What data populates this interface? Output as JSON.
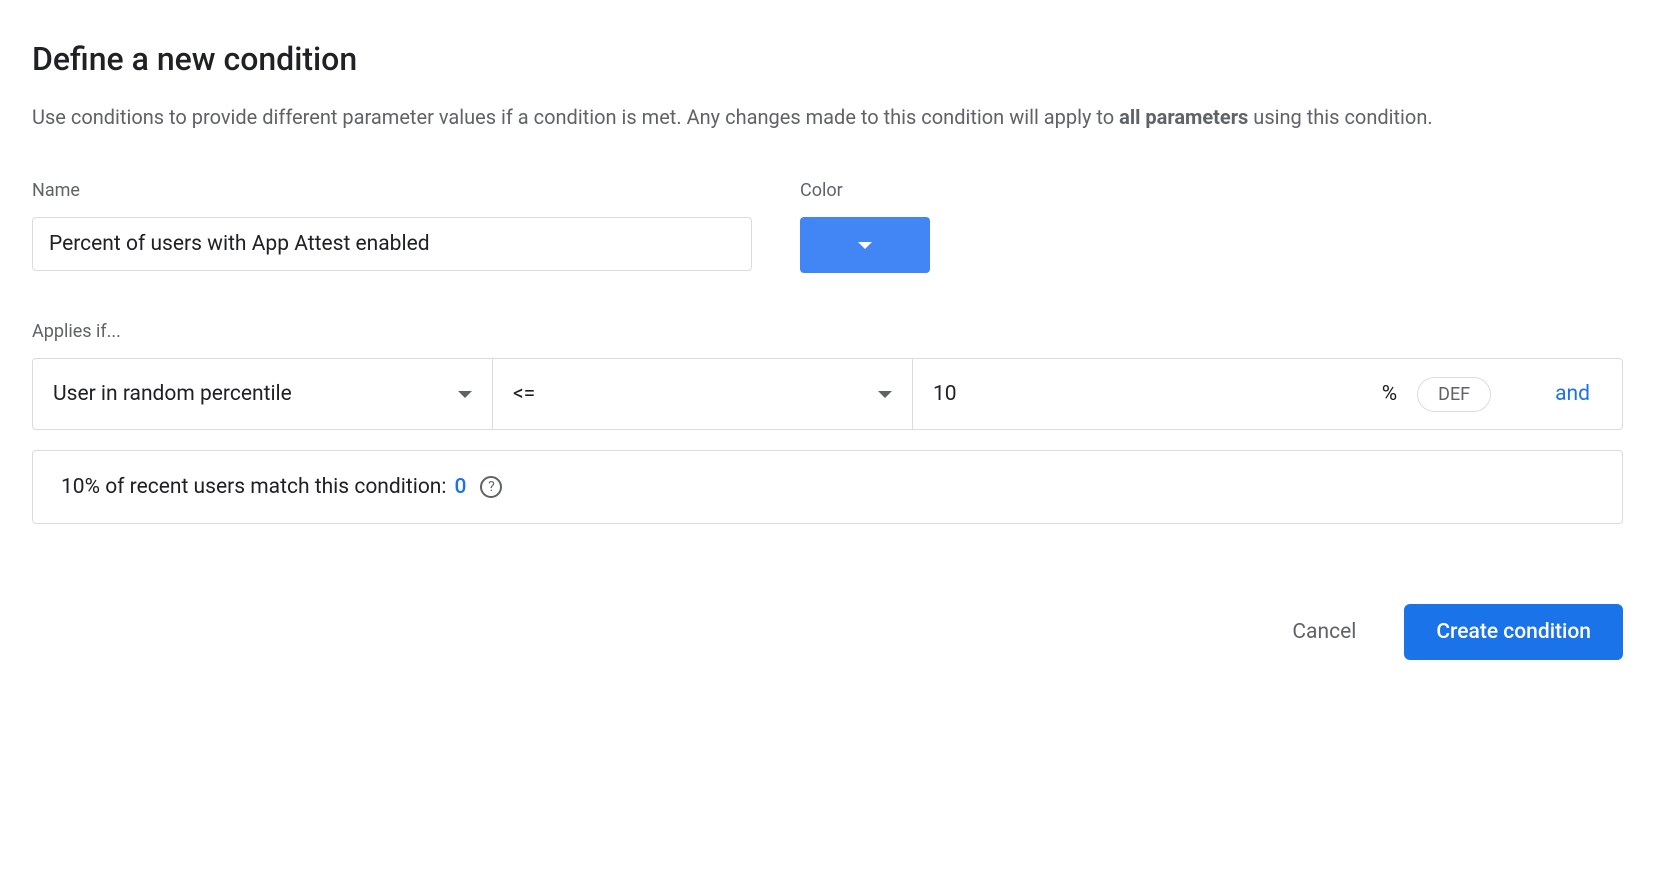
{
  "title": "Define a new condition",
  "description": {
    "before": "Use conditions to provide different parameter values if a condition is met. Any changes made to this condition will apply to ",
    "bold": "all parameters",
    "after": " using this condition."
  },
  "fields": {
    "name_label": "Name",
    "name_value": "Percent of users with App Attest enabled",
    "color_label": "Color",
    "color_value": "#4285f4"
  },
  "applies": {
    "label": "Applies if...",
    "type": "User in random percentile",
    "operator": "<=",
    "value": "10",
    "unit": "%",
    "chip": "DEF",
    "and_label": "and"
  },
  "match": {
    "prefix": "10% of recent users match this condition: ",
    "count": "0"
  },
  "actions": {
    "cancel": "Cancel",
    "create": "Create condition"
  }
}
